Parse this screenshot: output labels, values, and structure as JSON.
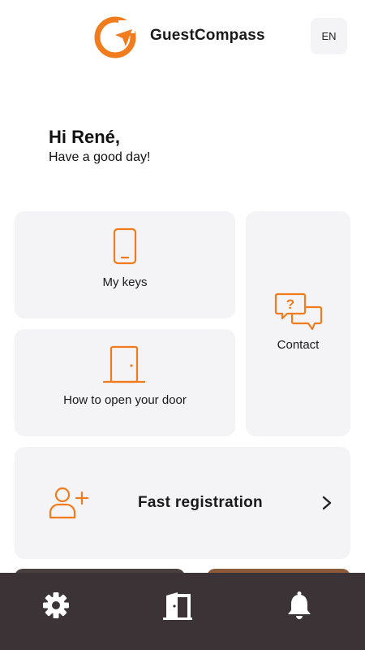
{
  "header": {
    "brand_name": "GuestCompass",
    "language": "EN"
  },
  "greeting": {
    "title": "Hi René,",
    "subtitle": "Have a good day!"
  },
  "cards": {
    "my_keys": "My keys",
    "open_door": "How to open your door",
    "contact": "Contact",
    "fast_registration": "Fast registration"
  },
  "icons": {
    "logo": "compass-logo-icon",
    "keys": "phone-icon",
    "door": "door-icon",
    "contact": "chat-question-icon",
    "registration": "add-person-icon",
    "chevron": "chevron-right-icon",
    "nav_settings": "gear-icon",
    "nav_door": "door-open-icon",
    "nav_notifications": "bell-icon"
  },
  "colors": {
    "accent": "#f07c1e",
    "card_background": "#f4f4f6",
    "nav_background": "#3b3336"
  }
}
